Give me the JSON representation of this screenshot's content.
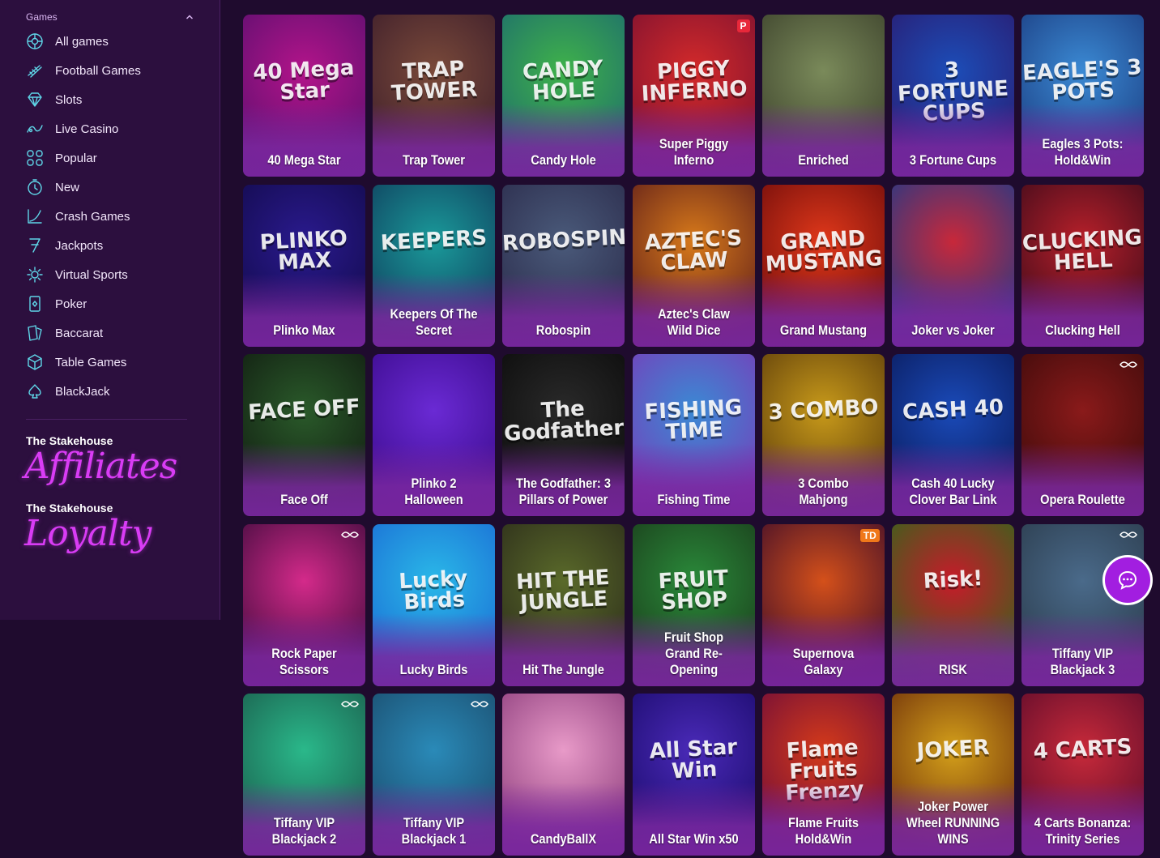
{
  "sidebar": {
    "section_label": "Games",
    "items": [
      {
        "label": "All games",
        "icon": "all-games-icon"
      },
      {
        "label": "Football Games",
        "icon": "football-icon"
      },
      {
        "label": "Slots",
        "icon": "diamond-icon"
      },
      {
        "label": "Live Casino",
        "icon": "live-casino-icon"
      },
      {
        "label": "Popular",
        "icon": "popular-icon"
      },
      {
        "label": "New",
        "icon": "new-icon"
      },
      {
        "label": "Crash Games",
        "icon": "crash-icon"
      },
      {
        "label": "Jackpots",
        "icon": "jackpot-icon"
      },
      {
        "label": "Virtual Sports",
        "icon": "virtual-sports-icon"
      },
      {
        "label": "Poker",
        "icon": "poker-icon"
      },
      {
        "label": "Baccarat",
        "icon": "baccarat-icon"
      },
      {
        "label": "Table Games",
        "icon": "table-games-icon"
      },
      {
        "label": "BlackJack",
        "icon": "blackjack-icon"
      }
    ],
    "affiliates": {
      "title": "The Stakehouse",
      "script": "Affiliates"
    },
    "loyalty": {
      "title": "The Stakehouse",
      "script": "Loyalty"
    }
  },
  "games": [
    {
      "name": "40 Mega Star",
      "art": "40 Mega Star",
      "bg": [
        "#b3148a",
        "#5a0f6e"
      ]
    },
    {
      "name": "Trap Tower",
      "art": "TRAP TOWER",
      "bg": [
        "#7a4a3a",
        "#3b1c2a"
      ]
    },
    {
      "name": "Candy Hole",
      "art": "CANDY HOLE",
      "bg": [
        "#3fb24a",
        "#1c6a6e"
      ]
    },
    {
      "name": "Super Piggy Inferno",
      "art": "PIGGY INFERNO",
      "bg": [
        "#d42a2a",
        "#7a1030"
      ],
      "badge": "P",
      "badge_color": "#e8283a"
    },
    {
      "name": "Enriched",
      "art": "",
      "bg": [
        "#7a8a5a",
        "#3a3f2a"
      ]
    },
    {
      "name": "3 Fortune Cups",
      "art": "3 FORTUNE CUPS",
      "bg": [
        "#1c4db8",
        "#2a1a6e"
      ]
    },
    {
      "name": "Eagles 3 Pots: Hold&Win",
      "art": "EAGLE'S 3 POTS",
      "bg": [
        "#3b8ad4",
        "#1a3a7e"
      ]
    },
    {
      "name": "Plinko Max",
      "art": "PLINKO MAX",
      "bg": [
        "#2a1a8e",
        "#120a4a"
      ]
    },
    {
      "name": "Keepers Of The Secret",
      "art": "KEEPERS",
      "bg": [
        "#1a9a9a",
        "#0f3a5a"
      ]
    },
    {
      "name": "Robospin",
      "art": "ROBOSPIN",
      "bg": [
        "#4a5a7a",
        "#2a2a4a"
      ]
    },
    {
      "name": "Aztec's Claw Wild Dice",
      "art": "AZTEC'S CLAW",
      "bg": [
        "#d87a1a",
        "#5a1a1a"
      ]
    },
    {
      "name": "Grand Mustang",
      "art": "GRAND MUSTANG",
      "bg": [
        "#e0381a",
        "#6a0a0a"
      ]
    },
    {
      "name": "Joker vs Joker",
      "art": "",
      "bg": [
        "#c8283a",
        "#1a3a8a"
      ]
    },
    {
      "name": "Clucking Hell",
      "art": "CLUCKING HELL",
      "bg": [
        "#b8202a",
        "#3a0a1a"
      ]
    },
    {
      "name": "Face Off",
      "art": "FACE OFF",
      "bg": [
        "#2a5a2a",
        "#101a10"
      ]
    },
    {
      "name": "Plinko 2 Halloween",
      "art": "",
      "bg": [
        "#6a2ad4",
        "#3a0a8a"
      ]
    },
    {
      "name": "The Godfather: 3 Pillars of Power",
      "art": "The Godfather",
      "bg": [
        "#2a2a2a",
        "#0a0a0a"
      ]
    },
    {
      "name": "Fishing Time",
      "art": "FISHING TIME",
      "bg": [
        "#3a8ad4",
        "#7a3ab8"
      ]
    },
    {
      "name": "3 Combo Mahjong",
      "art": "3 COMBO",
      "bg": [
        "#c89a1a",
        "#5a3a0a"
      ]
    },
    {
      "name": "Cash 40 Lucky Clover Bar Link",
      "art": "CASH 40",
      "bg": [
        "#1a4ab8",
        "#0a1a5a"
      ]
    },
    {
      "name": "Opera Roulette",
      "art": "",
      "bg": [
        "#8a1a1a",
        "#3a0a0a"
      ],
      "live": true
    },
    {
      "name": "Rock Paper Scissors",
      "art": "",
      "bg": [
        "#d42a8a",
        "#3a0a3a"
      ],
      "live": true
    },
    {
      "name": "Lucky Birds",
      "art": "Lucky Birds",
      "bg": [
        "#2ab8e8",
        "#1a6ad4"
      ]
    },
    {
      "name": "Hit The Jungle",
      "art": "HIT THE JUNGLE",
      "bg": [
        "#5a6a2a",
        "#2a2a1a"
      ]
    },
    {
      "name": "Fruit Shop Grand Re-Opening",
      "art": "FRUIT SHOP",
      "bg": [
        "#2a8a3a",
        "#1a3a1a"
      ]
    },
    {
      "name": "Supernova Galaxy",
      "art": "",
      "bg": [
        "#d4501a",
        "#3a0a2a"
      ],
      "badge": "TD",
      "badge_color": "#f0781a"
    },
    {
      "name": "RISK",
      "art": "Risk!",
      "bg": [
        "#c81a2a",
        "#2a6a1a"
      ]
    },
    {
      "name": "Tiffany VIP Blackjack 3",
      "art": "",
      "bg": [
        "#4a6a8a",
        "#2a3a4a"
      ],
      "live": true
    },
    {
      "name": "Tiffany VIP Blackjack 2",
      "art": "",
      "bg": [
        "#2ab88a",
        "#1a5a4a"
      ],
      "live": true
    },
    {
      "name": "Tiffany VIP Blackjack 1",
      "art": "",
      "bg": [
        "#2a8ab8",
        "#1a4a6a"
      ],
      "live": true
    },
    {
      "name": "CandyBallX",
      "art": "",
      "bg": [
        "#e89ac8",
        "#8a3a7a"
      ]
    },
    {
      "name": "All Star Win x50",
      "art": "All Star Win",
      "bg": [
        "#4a2ab8",
        "#1a0a6a"
      ]
    },
    {
      "name": "Flame Fruits Hold&Win",
      "art": "Flame Fruits Frenzy",
      "bg": [
        "#d43a1a",
        "#6a0a3a"
      ]
    },
    {
      "name": "Joker Power Wheel RUNNING WINS",
      "art": "JOKER",
      "bg": [
        "#d4a01a",
        "#6a2a0a"
      ]
    },
    {
      "name": "4 Carts Bonanza: Trinity Series",
      "art": "4 CARTS",
      "bg": [
        "#c82a3a",
        "#5a0a2a"
      ]
    }
  ]
}
